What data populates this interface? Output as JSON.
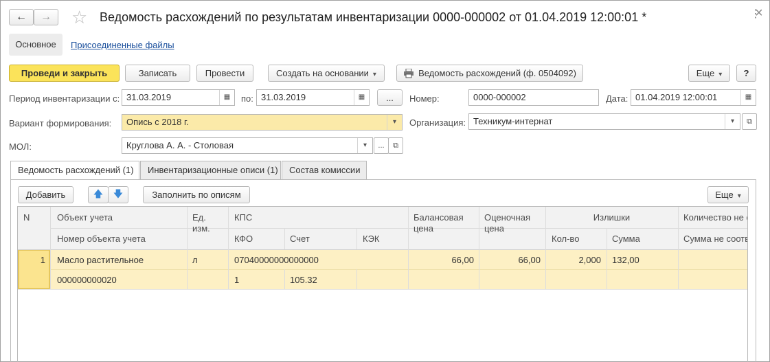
{
  "window": {
    "title": "Ведомость расхождений по результатам инвентаризации 0000-000002 от 01.04.2019 12:00:01 *",
    "close_glyph": "×",
    "more_glyph": "⋮"
  },
  "nav": {
    "back_glyph": "←",
    "forward_glyph": "→",
    "favorite_glyph": "☆"
  },
  "sections": {
    "main": "Основное",
    "attached_files": "Присоединенные файлы"
  },
  "toolbar": {
    "post_close": "Проведи и закрыть",
    "save": "Записать",
    "post": "Провести",
    "create_based_on": "Создать на основании",
    "print_report": "Ведомость расхождений (ф. 0504092)",
    "more": "Еще",
    "help": "?"
  },
  "form": {
    "period_label": "Период инвентаризации с:",
    "period_from": "31.03.2019",
    "period_to_label": "по:",
    "period_to": "31.03.2019",
    "period_more": "...",
    "number_label": "Номер:",
    "number": "0000-000002",
    "date_label": "Дата:",
    "date": "01.04.2019 12:00:01",
    "variant_label": "Вариант формирования:",
    "variant": "Опись с 2018 г.",
    "org_label": "Организация:",
    "org": "Техникум-интернат",
    "mol_label": "МОЛ:",
    "mol": "Круглова А. А. - Столовая",
    "mol_more": "..."
  },
  "tabs": [
    {
      "label": "Ведомость расхождений (1)"
    },
    {
      "label": "Инвентаризационные описи (1)"
    },
    {
      "label": "Состав комиссии"
    }
  ],
  "table_toolbar": {
    "add": "Добавить",
    "up_glyph": "🡅",
    "down_glyph": "🡇",
    "fill": "Заполнить по описям",
    "more": "Еще"
  },
  "table": {
    "headers": {
      "n": "N",
      "object": "Объект учета",
      "object_number": "Номер объекта учета",
      "unit_1": "Ед.",
      "unit_2": "изм.",
      "kps": "КПС",
      "kfo": "КФО",
      "account": "Счет",
      "kek": "КЭК",
      "balance_price_1": "Балансовая",
      "balance_price_2": "цена",
      "estimated_price_1": "Оценочная",
      "estimated_price_2": "цена",
      "surplus": "Излишки",
      "qty": "Кол-во",
      "sum": "Сумма",
      "qty_mismatch": "Количество не с",
      "sum_mismatch": "Сумма не соотв"
    },
    "rows": [
      {
        "n": "1",
        "object": "Масло растительное",
        "object_number": "000000000020",
        "unit": "л",
        "kps": "07040000000000000",
        "kfo": "1",
        "account": "105.32",
        "kek": "",
        "balance_price": "66,00",
        "estimated_price": "66,00",
        "qty": "2,000",
        "sum": "132,00"
      }
    ]
  },
  "colors": {
    "accent": "#fbe35a",
    "row_highlight": "#fdf0c4",
    "field_yellow": "#fbeaa9"
  }
}
